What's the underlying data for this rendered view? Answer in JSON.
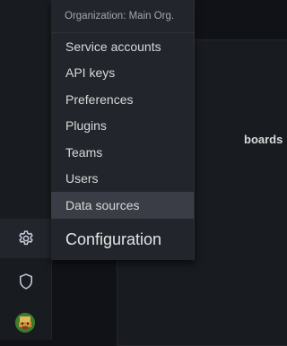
{
  "menu": {
    "header": "Organization: Main Org.",
    "items": [
      {
        "label": "Service accounts"
      },
      {
        "label": "API keys"
      },
      {
        "label": "Preferences"
      },
      {
        "label": "Plugins"
      },
      {
        "label": "Teams"
      },
      {
        "label": "Users"
      },
      {
        "label": "Data sources",
        "active": true
      }
    ],
    "title": "Configuration"
  },
  "background": {
    "panel_text": "boards"
  },
  "sidebar": {
    "icons": [
      "gear-icon",
      "shield-icon",
      "avatar"
    ]
  },
  "colors": {
    "background": "#111217",
    "menu_bg": "#22252b",
    "active_item": "#3a3d45",
    "text": "#d8d9da"
  }
}
